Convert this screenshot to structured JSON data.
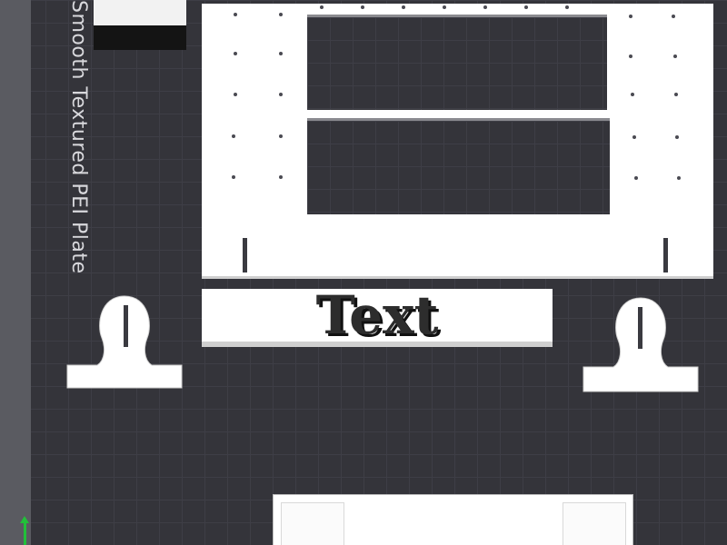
{
  "viewport": {
    "plate_label": "Smooth Textured PEI Plate"
  },
  "objects": {
    "text_tag_label": "Text"
  },
  "colors": {
    "background": "#34343a",
    "grid_line": "#3e3e46",
    "model_fill": "#ffffff",
    "axis_y": "#22c03a"
  },
  "icons": {
    "axis": "y-axis-arrow-icon"
  }
}
